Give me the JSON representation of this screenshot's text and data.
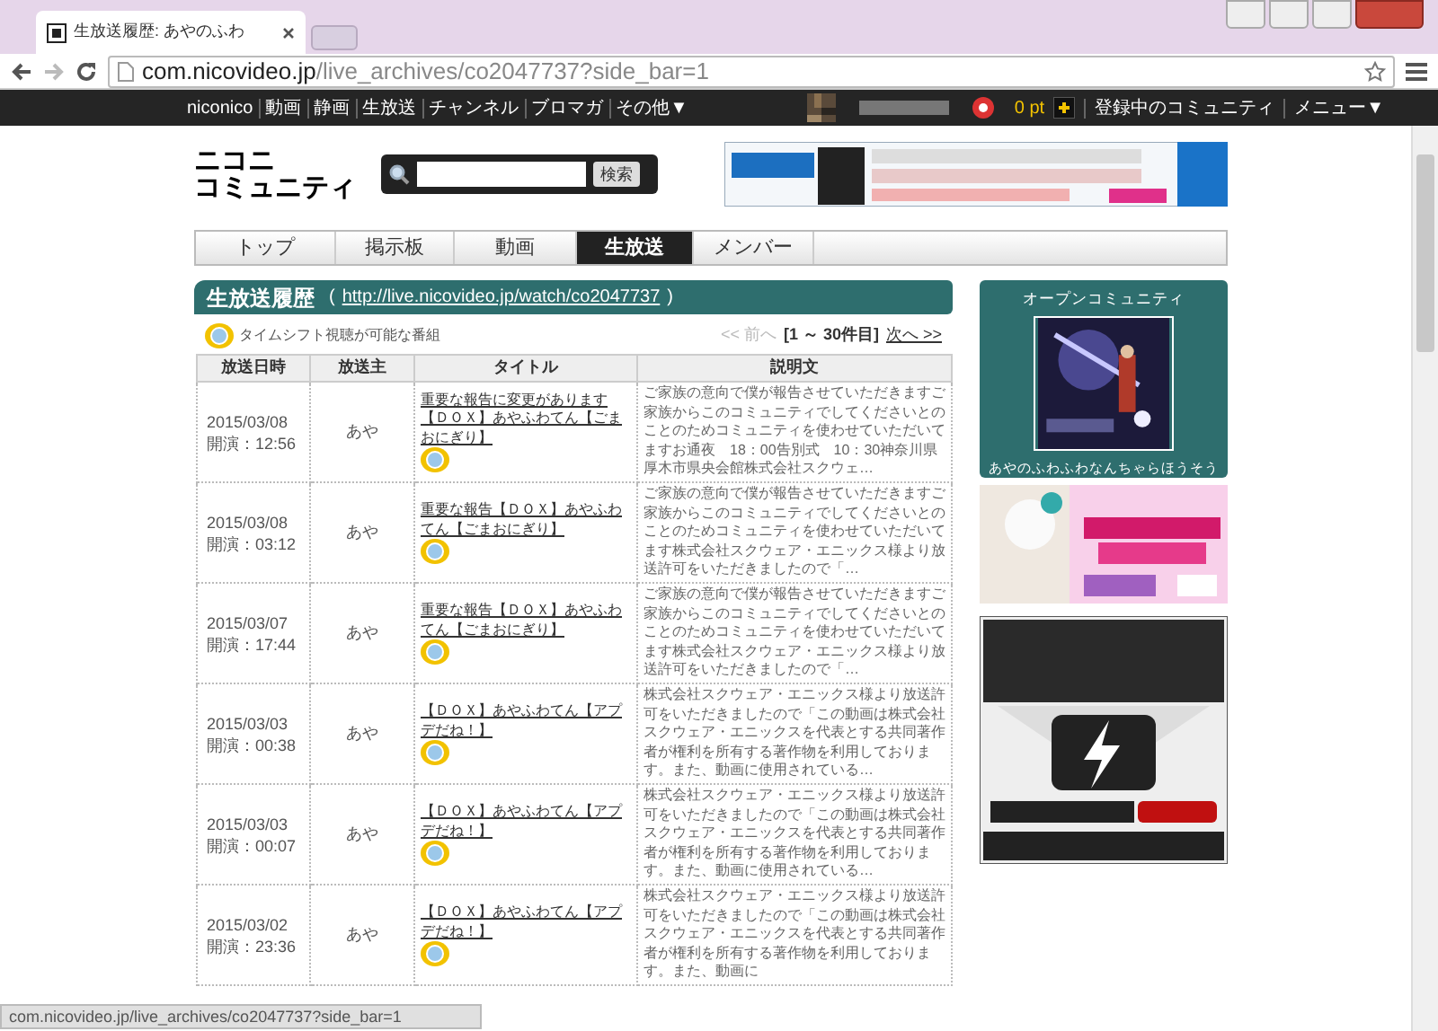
{
  "browser": {
    "tab_title": "生放送履歴: あやのふわ",
    "url_host": "com.nicovideo.jp",
    "url_path": "/live_archives/co2047737?side_bar=1"
  },
  "nav": {
    "items": [
      "niconico",
      "動画",
      "静画",
      "生放送",
      "チャンネル",
      "ブロマガ",
      "その他▼"
    ],
    "points": "0 pt",
    "links": [
      "登録中のコミュニティ",
      "メニュー▼"
    ]
  },
  "header": {
    "logo_lines": [
      "ニコニ",
      "コミュニティ"
    ],
    "search_button": "検索"
  },
  "tabs": [
    {
      "label": "トップ",
      "selected": false
    },
    {
      "label": "掲示板",
      "selected": false
    },
    {
      "label": "動画",
      "selected": false
    },
    {
      "label": "生放送",
      "selected": true
    },
    {
      "label": "メンバー",
      "selected": false
    }
  ],
  "section": {
    "title": "生放送履歴",
    "link_open": "(",
    "link": "http://live.nicovideo.jp/watch/co2047737",
    "link_close": ")",
    "legend": "タイムシフト視聴が可能な番組",
    "pager": {
      "prev": "<< 前へ",
      "prev_disabled": true,
      "range": "[1 ～ 30件目]",
      "next": "次へ >>"
    }
  },
  "table": {
    "columns": [
      "放送日時",
      "放送主",
      "タイトル",
      "説明文"
    ],
    "rows": [
      {
        "date": "2015/03/08",
        "time": "開演：12:56",
        "host": "あや",
        "title": "重要な報告に変更があります【ＤＯＸ】あやふわてん【ごまおにぎり】",
        "timeshift": true,
        "description": "ご家族の意向で僕が報告させていただきますご家族からこのコミュニティでしてくださいとのことのためコミュニティを使わせていただいてますお通夜　18：00告別式　10：30神奈川県厚木市県央会館株式会社スクウェ…"
      },
      {
        "date": "2015/03/08",
        "time": "開演：03:12",
        "host": "あや",
        "title": "重要な報告【ＤＯＸ】あやふわてん【ごまおにぎり】",
        "timeshift": true,
        "description": "ご家族の意向で僕が報告させていただきますご家族からこのコミュニティでしてくださいとのことのためコミュニティを使わせていただいてます株式会社スクウェア・エニックス様より放送許可をいただきましたので「…"
      },
      {
        "date": "2015/03/07",
        "time": "開演：17:44",
        "host": "あや",
        "title": "重要な報告【ＤＯＸ】あやふわてん【ごまおにぎり】",
        "timeshift": true,
        "description": "ご家族の意向で僕が報告させていただきますご家族からこのコミュニティでしてくださいとのことのためコミュニティを使わせていただいてます株式会社スクウェア・エニックス様より放送許可をいただきましたので「…"
      },
      {
        "date": "2015/03/03",
        "time": "開演：00:38",
        "host": "あや",
        "title": "【ＤＯＸ】あやふわてん【アプデだね！】",
        "timeshift": true,
        "description": "株式会社スクウェア・エニックス様より放送許可をいただきましたので「この動画は株式会社スクウェア・エニックスを代表とする共同著作者が権利を所有する著作物を利用しております。また、動画に使用されている…"
      },
      {
        "date": "2015/03/03",
        "time": "開演：00:07",
        "host": "あや",
        "title": "【ＤＯＸ】あやふわてん【アプデだね！】",
        "timeshift": true,
        "description": "株式会社スクウェア・エニックス様より放送許可をいただきましたので「この動画は株式会社スクウェア・エニックスを代表とする共同著作者が権利を所有する著作物を利用しております。また、動画に使用されている…"
      },
      {
        "date": "2015/03/02",
        "time": "開演：23:36",
        "host": "あや",
        "title": "【ＤＯＸ】あやふわてん【アプデだね！】",
        "timeshift": true,
        "description": "株式会社スクウェア・エニックス様より放送許可をいただきましたので「この動画は株式会社スクウェア・エニックスを代表とする共同著作者が権利を所有する著作物を利用しております。また、動画に"
      }
    ]
  },
  "sidebar": {
    "heading": "オープンコミュニティ",
    "community_name": "あやのふわふわなんちゃらほうそう"
  },
  "status_bar": "com.nicovideo.jp/live_archives/co2047737?side_bar=1"
}
